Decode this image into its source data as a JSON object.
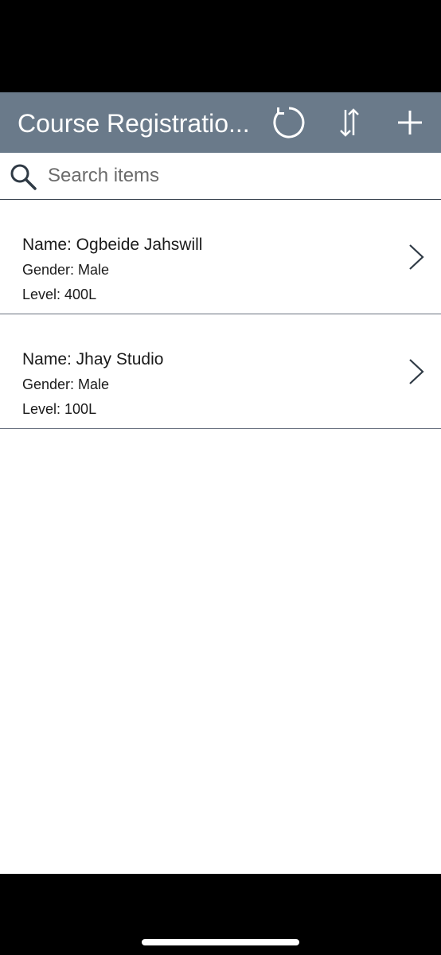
{
  "header": {
    "title": "Course Registratio...",
    "refresh_icon": "refresh-icon",
    "sort_icon": "sort-icon",
    "add_icon": "add-icon",
    "background": "#6a7a8a"
  },
  "search": {
    "placeholder": "Search items",
    "value": ""
  },
  "items": [
    {
      "title": "Name: Ogbeide Jahswill",
      "gender": "Gender: Male",
      "level": "Level: 400L"
    },
    {
      "title": "Name: Jhay Studio",
      "gender": "Gender: Male",
      "level": "Level: 100L"
    }
  ]
}
